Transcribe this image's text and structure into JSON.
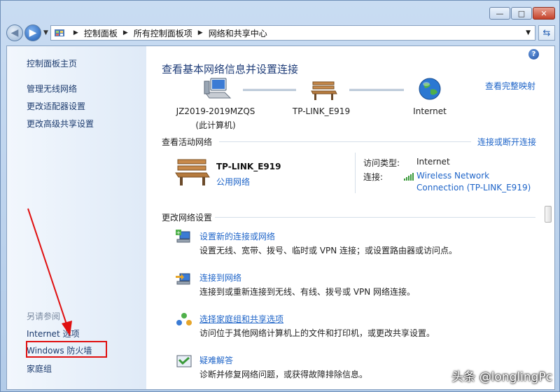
{
  "window": {
    "caption": {
      "minimize": "—",
      "maximize": "□",
      "close": "✕"
    }
  },
  "navbar": {
    "breadcrumbs": [
      "控制面板",
      "所有控制面板项",
      "网络和共享中心"
    ],
    "refresh_icon": "refresh-icon"
  },
  "sidebar": {
    "home": "控制面板主页",
    "links": [
      "管理无线网络",
      "更改适配器设置",
      "更改高级共享设置"
    ],
    "see_also": "另请参阅",
    "bottom_links": [
      "Internet 选项",
      "Windows 防火墙",
      "家庭组"
    ]
  },
  "main": {
    "title": "查看基本网络信息并设置连接",
    "full_map": "查看完整映射",
    "map": {
      "computer_name": "JZ2019-2019MZQS",
      "computer_sub": "(此计算机)",
      "router": "TP-LINK_E919",
      "internet": "Internet"
    },
    "active_title": "查看活动网络",
    "connect_link": "连接或断开连接",
    "active": {
      "name": "TP-LINK_E919",
      "type": "公用网络",
      "access_key": "访问类型:",
      "access_val": "Internet",
      "conn_key": "连接:",
      "conn_line1": "Wireless Network",
      "conn_line2": "Connection (TP-LINK_E919)"
    },
    "change_title": "更改网络设置",
    "tasks": [
      {
        "link": "设置新的连接或网络",
        "desc": "设置无线、宽带、拨号、临时或 VPN 连接；或设置路由器或访问点。"
      },
      {
        "link": "连接到网络",
        "desc": "连接到或重新连接到无线、有线、拨号或 VPN 网络连接。"
      },
      {
        "link": "选择家庭组和共享选项",
        "desc": "访问位于其他网络计算机上的文件和打印机，或更改共享设置。"
      },
      {
        "link": "疑难解答",
        "desc": "诊断并修复网络问题，或获得故障排除信息。"
      }
    ]
  },
  "watermark": "头条 @longlingPc",
  "colors": {
    "link": "#1e64c8",
    "title": "#1e3c78",
    "annotation": "#e01010"
  }
}
